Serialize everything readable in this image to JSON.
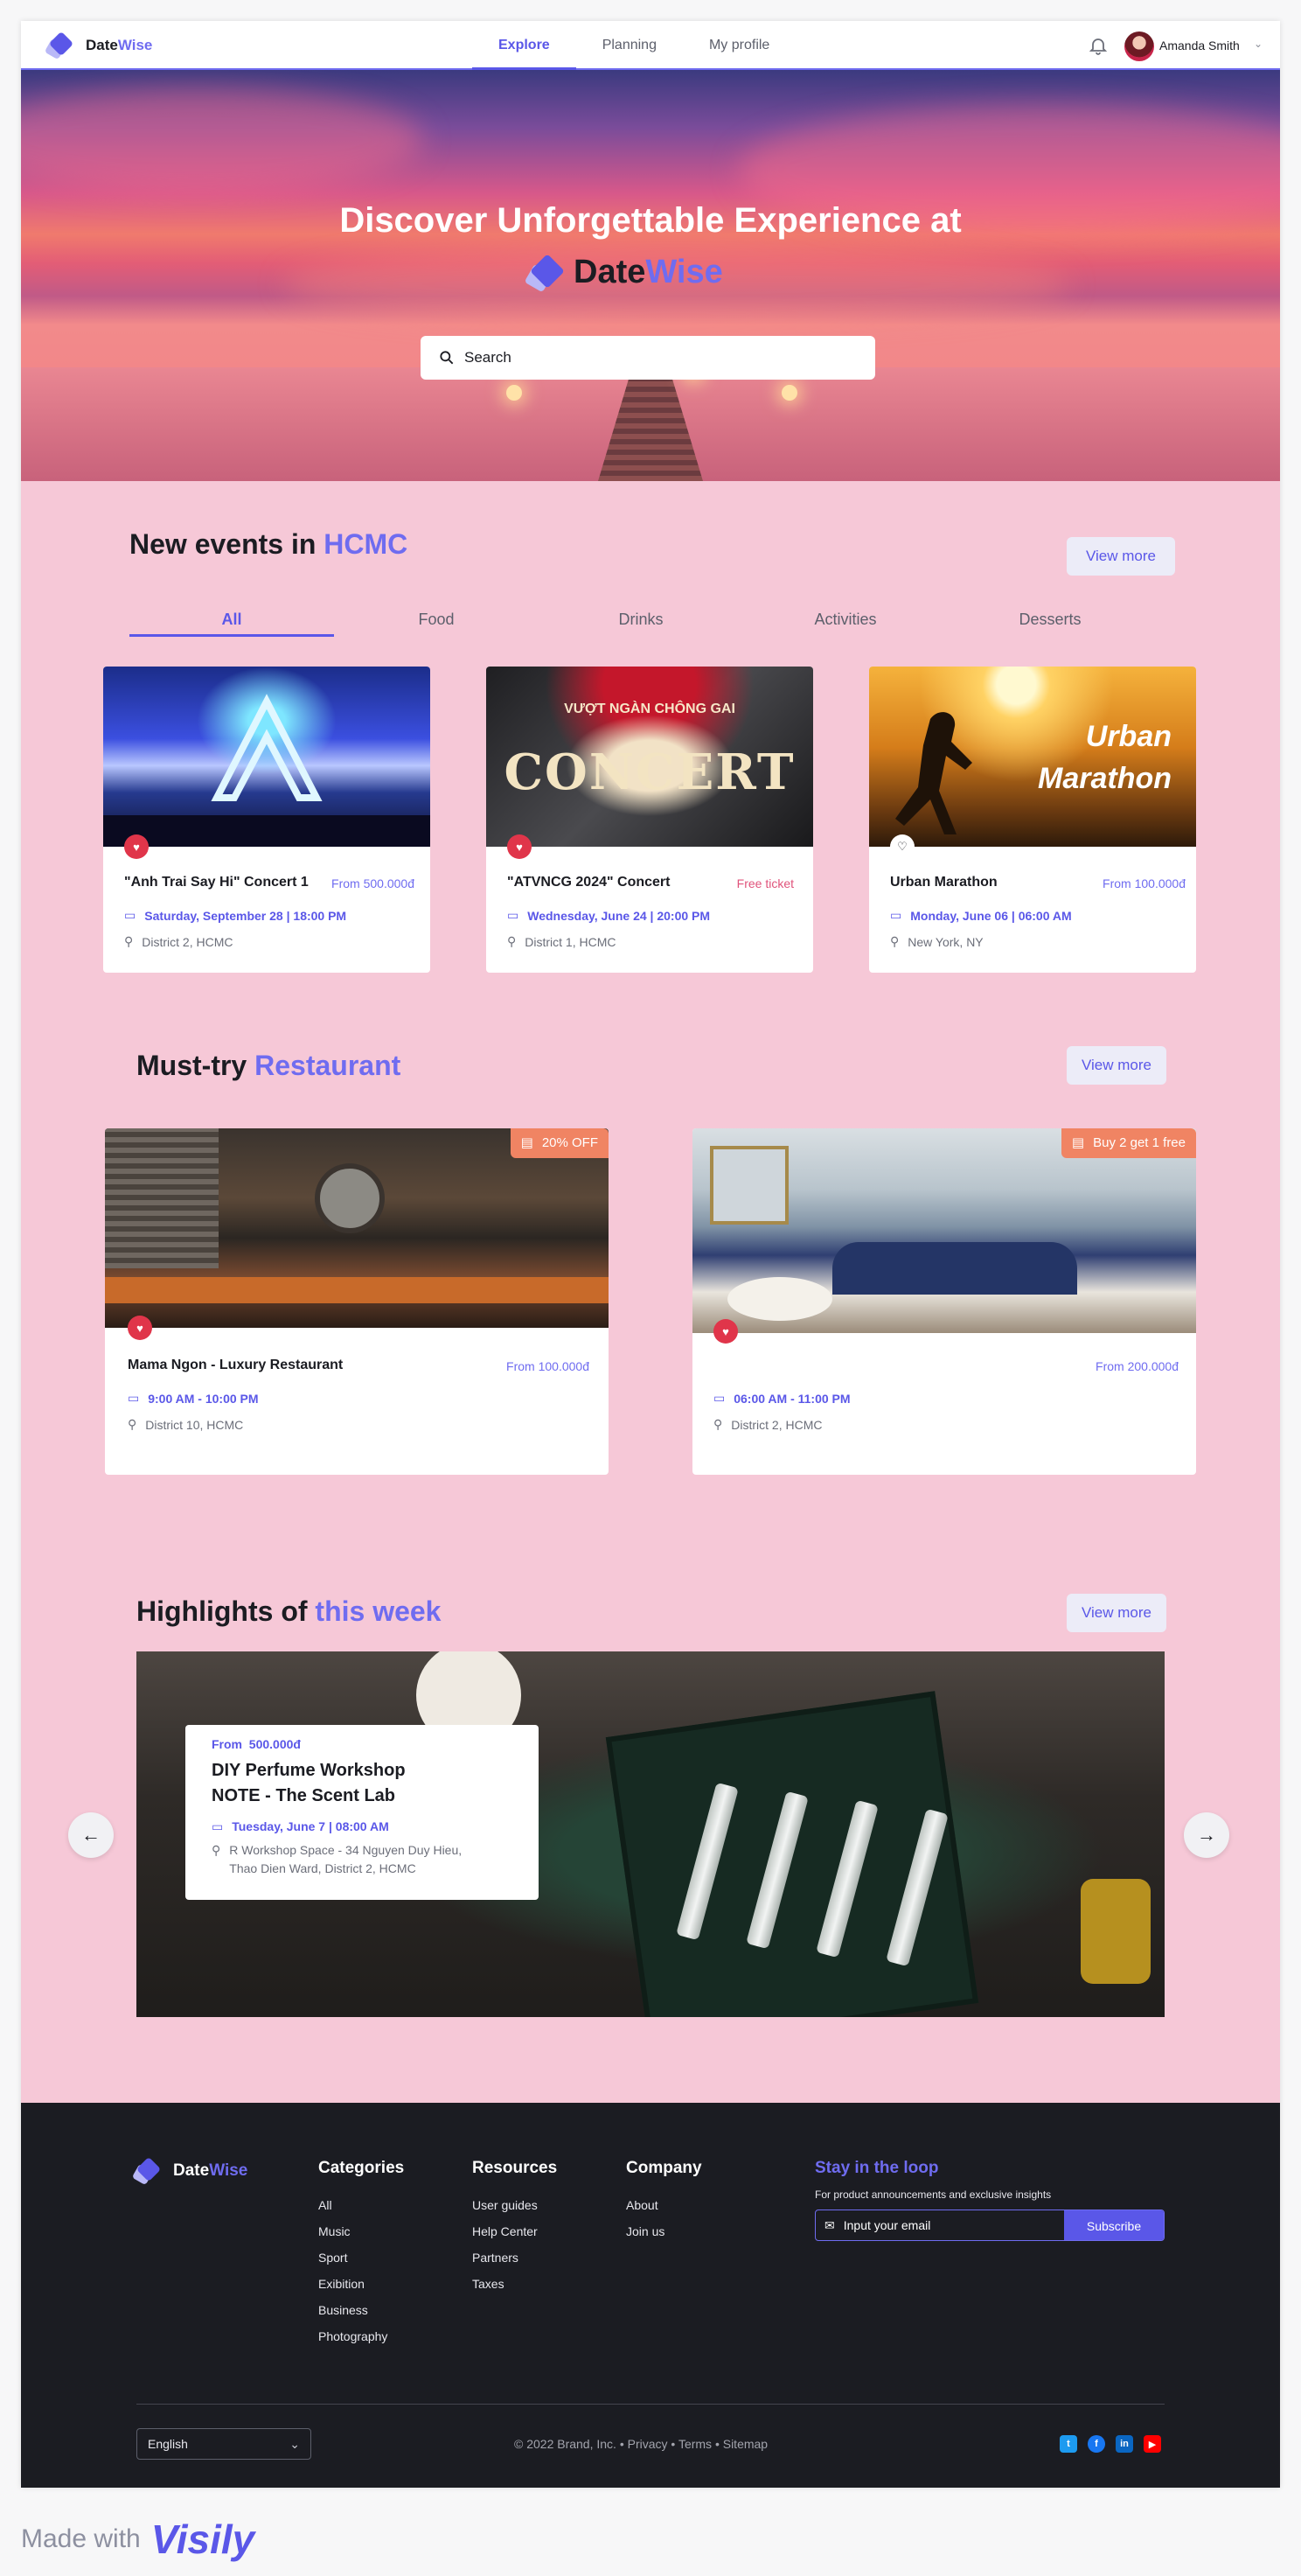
{
  "app": {
    "brand_first": "Date",
    "brand_second": "Wise"
  },
  "nav": {
    "tabs": [
      "Explore",
      "Planning",
      "My profile"
    ],
    "active_tab": "Explore",
    "user_name": "Amanda Smith"
  },
  "hero": {
    "headline": "Discover Unforgettable Experience at",
    "search_placeholder": "Search"
  },
  "events": {
    "title_prefix": "New events in",
    "title_highlight": "HCMC",
    "view_more": "View more",
    "categories": [
      "All",
      "Food",
      "Drinks",
      "Activities",
      "Desserts"
    ],
    "active_category": "All",
    "cards": [
      {
        "name": "\"Anh Trai Say Hi\" Concert 1",
        "price": "From 500.000đ",
        "date": "Saturday, September 28 | 18:00 PM",
        "location": "District 2, HCMC",
        "favorited": true
      },
      {
        "name": "\"ATVNCG 2024\" Concert",
        "price": "Free ticket",
        "date": "Wednesday, June 24 | 20:00 PM",
        "location": "District 1, HCMC",
        "favorited": true,
        "image_text_top": "VƯỢT NGÀN CHÔNG GAI",
        "image_text": "CONCERT"
      },
      {
        "name": "Urban Marathon",
        "price": "From 100.000đ",
        "date": "Monday, June 06 | 06:00 AM",
        "location": "New York, NY",
        "favorited": false,
        "image_text_1": "Urban",
        "image_text_2": "Marathon"
      }
    ]
  },
  "restaurants": {
    "title_prefix": "Must-try",
    "title_highlight": "Restaurant",
    "view_more": "View more",
    "cards": [
      {
        "name": "Mama Ngon - Luxury Restaurant",
        "badge": "20% OFF",
        "price": "From 100.000đ",
        "hours": "9:00 AM - 10:00 PM",
        "location": "District 10, HCMC"
      },
      {
        "name": "",
        "badge": "Buy 2 get 1 free",
        "price": "From 200.000đ",
        "hours": "06:00 AM - 11:00 PM",
        "location": "District 2, HCMC"
      }
    ]
  },
  "highlights": {
    "title_prefix": "Highlights of",
    "title_highlight": "this week",
    "view_more": "View more",
    "card": {
      "price_prefix": "From",
      "price": "500.000đ",
      "name_line1": "DIY Perfume Workshop",
      "name_line2": "NOTE - The Scent Lab",
      "date": "Tuesday, June 7 | 08:00 AM",
      "address_line1": "R Workshop Space - 34 Nguyen Duy Hieu,",
      "address_line2": "Thao Dien Ward, District 2, HCMC"
    }
  },
  "footer": {
    "categories_title": "Categories",
    "categories": [
      "All",
      "Music",
      "Sport",
      "Exibition",
      "Business",
      "Photography"
    ],
    "resources_title": "Resources",
    "resources": [
      "User guides",
      "Help Center",
      "Partners",
      "Taxes"
    ],
    "company_title": "Company",
    "company": [
      "About",
      "Join us"
    ],
    "loop_title": "Stay in the loop",
    "loop_text": "For product announcements and exclusive insights",
    "email_placeholder": "Input your email",
    "subscribe": "Subscribe",
    "language": "English",
    "copyright": "© 2022 Brand, Inc. • Privacy • Terms • Sitemap",
    "social": [
      "twitter-icon",
      "facebook-icon",
      "linkedin-icon",
      "youtube-icon"
    ]
  },
  "made_with": {
    "prefix": "Made with",
    "brand": "Visily"
  },
  "colors": {
    "accent": "#5a57e8",
    "accent_light": "#6f6cf0",
    "page_bg": "#f6c8d7",
    "footer_bg": "#1b1c22",
    "favorite": "#e0354a",
    "badge": "#f08463",
    "free": "#e0537b"
  }
}
